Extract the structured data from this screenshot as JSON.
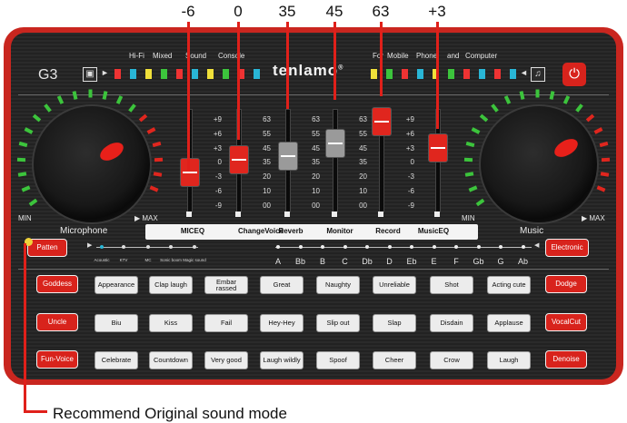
{
  "callouts": [
    "-6",
    "0",
    "35",
    "45",
    "63",
    "+3"
  ],
  "top_labels": {
    "left": [
      "Hi-Fi",
      "Mixed",
      "Sound",
      "Console"
    ],
    "right": [
      "For",
      "Mobile",
      "Phone",
      "and",
      "Computer"
    ]
  },
  "brand": "tenlamo",
  "brand_mark": "®",
  "model": "G3",
  "icons": {
    "profile": "profile-card-icon",
    "music": "music-note-icon",
    "power": "power-icon"
  },
  "glyphs": {
    "power": "⏻",
    "music": "♫",
    "profile": "▣"
  },
  "dials": {
    "left": {
      "min": "MIN",
      "max": "MAX",
      "label": "Microphone"
    },
    "right": {
      "min": "MIN",
      "max": "MAX",
      "label": "Music"
    }
  },
  "fader_scales": [
    [
      "+9",
      "+6",
      "+3",
      "0",
      "-3",
      "-6",
      "-9"
    ],
    [
      "63",
      "55",
      "45",
      "35",
      "20",
      "10",
      "00"
    ],
    [
      "63",
      "55",
      "45",
      "35",
      "20",
      "10",
      "00"
    ],
    [
      "63",
      "55",
      "45",
      "35",
      "20",
      "10",
      "00"
    ],
    [
      "+9",
      "+6",
      "+3",
      "0",
      "-3",
      "-6",
      "-9"
    ]
  ],
  "faders": [
    {
      "name": "MICEQ",
      "value": "-6",
      "level": 0.33,
      "color": "#e0261e"
    },
    {
      "name": "ChangeVoice",
      "value": "0",
      "level": 0.5,
      "color": "#e0261e"
    },
    {
      "name": "Reverb",
      "value": "35",
      "level": 0.55,
      "color": "#9a9a9a"
    },
    {
      "name": "Monitor",
      "value": "45",
      "level": 0.72,
      "color": "#9a9a9a"
    },
    {
      "name": "Record",
      "value": "63",
      "level": 1.0,
      "color": "#e0261e"
    },
    {
      "name": "MusicEQ",
      "value": "+3",
      "level": 0.66,
      "color": "#e0261e"
    }
  ],
  "modes": {
    "button": "Patten",
    "labels": [
      "Acoustic",
      "KTV",
      "MC",
      "Sonic boom",
      "Magic sound"
    ]
  },
  "keys": [
    "A",
    "Bb",
    "B",
    "C",
    "Db",
    "D",
    "Eb",
    "E",
    "F",
    "Gb",
    "G",
    "Ab"
  ],
  "electronic": "Electronic",
  "left_buttons": [
    "Goddess",
    "Uncle",
    "Fun-Voice"
  ],
  "right_buttons": [
    "Dodge",
    "VocalCut",
    "Denoise"
  ],
  "sound_rows": [
    [
      "Appearance",
      "Clap laugh",
      "Embar rassed",
      "Great",
      "Naughty",
      "Unreliable",
      "Shot",
      "Acting cute"
    ],
    [
      "Biu",
      "Kiss",
      "Fail",
      "Hey-Hey",
      "Slip out",
      "Slap",
      "Disdain",
      "Applause"
    ],
    [
      "Celebrate",
      "Countdown",
      "Very good",
      "Laugh wildly",
      "Spoof",
      "Cheer",
      "Crow",
      "Laugh"
    ]
  ],
  "note": "Recommend Original sound mode",
  "colors": {
    "accent": "#d8231c",
    "panel": "#262626",
    "callout": "#e0201a",
    "ring_on": "#3cc43c",
    "ring_hot": "#e0261e"
  }
}
